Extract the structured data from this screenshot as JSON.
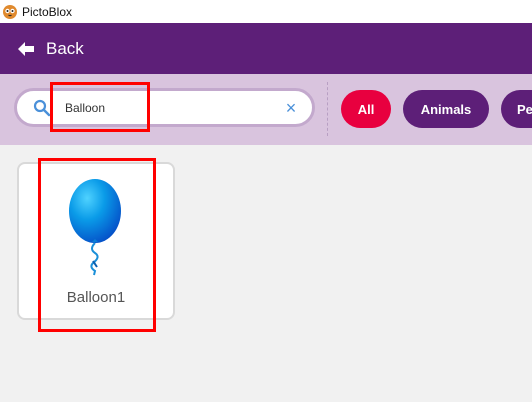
{
  "app": {
    "title": "PictoBlox"
  },
  "menubar": {
    "back_label": "Back"
  },
  "search": {
    "value": "Balloon",
    "clear_symbol": "×"
  },
  "filters": [
    {
      "label": "All",
      "active": true,
      "color": "#e8003f"
    },
    {
      "label": "Animals",
      "active": false,
      "color": "#5d1f78"
    },
    {
      "label": "Pe",
      "active": false,
      "color": "#5d1f78"
    }
  ],
  "sprites": [
    {
      "label": "Balloon1",
      "icon": "balloon-icon"
    }
  ],
  "colors": {
    "menubar": "#5d1f78",
    "filterbar": "#d9c4de",
    "accent": "#e8003f",
    "highlight": "#ff0000"
  }
}
